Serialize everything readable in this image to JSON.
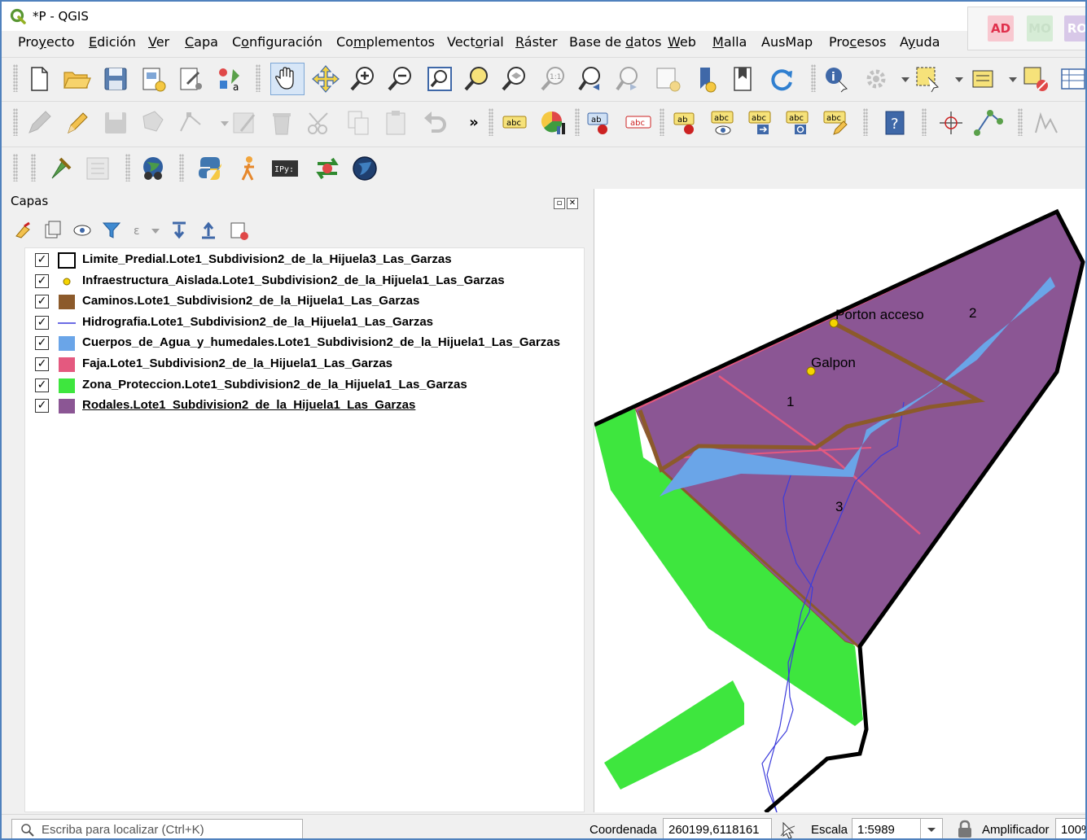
{
  "window": {
    "title": "*P - QGIS"
  },
  "corner_badges": [
    "AD",
    "MO",
    "RO"
  ],
  "menubar": [
    {
      "pre": "Pro",
      "ul": "y",
      "post": "ecto"
    },
    {
      "pre": "",
      "ul": "E",
      "post": "dición"
    },
    {
      "pre": "",
      "ul": "V",
      "post": "er"
    },
    {
      "pre": "",
      "ul": "C",
      "post": "apa"
    },
    {
      "pre": "C",
      "ul": "o",
      "post": "nfiguración"
    },
    {
      "pre": "Co",
      "ul": "m",
      "post": "plementos"
    },
    {
      "pre": "Vect",
      "ul": "o",
      "post": "rial"
    },
    {
      "pre": "",
      "ul": "R",
      "post": "áster"
    },
    {
      "pre": "Base de ",
      "ul": "d",
      "post": "atos"
    },
    {
      "pre": "",
      "ul": "W",
      "post": "eb"
    },
    {
      "pre": "",
      "ul": "M",
      "post": "alla"
    },
    {
      "pre": "AusMap",
      "ul": "",
      "post": ""
    },
    {
      "pre": "Pro",
      "ul": "c",
      "post": "esos"
    },
    {
      "pre": "A",
      "ul": "y",
      "post": "uda"
    }
  ],
  "toolbar": {
    "overflow": "»",
    "label_abc": "abc",
    "label_ab": "ab"
  },
  "layers_panel": {
    "title": "Capas",
    "layers": [
      {
        "checked": "✓",
        "symbol": "polygon-outline",
        "name": "Limite_Predial.Lote1_Subdivision2_de_la_Hijuela3_Las_Garzas",
        "color": "#000000"
      },
      {
        "checked": "✓",
        "symbol": "point",
        "name": "Infraestructura_Aislada.Lote1_Subdivision2_de_la_Hijuela1_Las_Garzas",
        "color": "#f5d400"
      },
      {
        "checked": "✓",
        "symbol": "fill",
        "name": "Caminos.Lote1_Subdivision2_de_la_Hijuela1_Las_Garzas",
        "color": "#8c5a2b"
      },
      {
        "checked": "✓",
        "symbol": "line",
        "name": "Hidrografia.Lote1_Subdivision2_de_la_Hijuela1_Las_Garzas",
        "color": "#3c3cdc"
      },
      {
        "checked": "✓",
        "symbol": "fill",
        "name": "Cuerpos_de_Agua_y_humedales.Lote1_Subdivision2_de_la_Hijuela1_Las_Garzas",
        "color": "#6aa5e8"
      },
      {
        "checked": "✓",
        "symbol": "fill",
        "name": "Faja.Lote1_Subdivision2_de_la_Hijuela1_Las_Garzas",
        "color": "#e4597f"
      },
      {
        "checked": "✓",
        "symbol": "fill",
        "name": "Zona_Proteccion.Lote1_Subdivision2_de_la_Hijuela1_Las_Garzas",
        "color": "#3ee63e"
      },
      {
        "checked": "✓",
        "symbol": "fill",
        "name": "Rodales.Lote1_Subdivision2_de_la_Hijuela1_Las_Garzas",
        "color": "#8b5694",
        "selected": true
      }
    ]
  },
  "map": {
    "labels": {
      "porton": "Porton acceso",
      "galpon": "Galpon",
      "stand1": "1",
      "stand2": "2",
      "stand3": "3"
    },
    "colors": {
      "stands": "#8b5694",
      "protection": "#3ee63e",
      "water": "#6aa5e8",
      "roads": "#8c5a2b",
      "strips": "#e4597f",
      "rivers": "#3c3cdc",
      "boundary": "#000000",
      "points": "#f5d400"
    }
  },
  "statusbar": {
    "locator_placeholder": "Escriba para localizar (Ctrl+K)",
    "coord_label": "Coordenada",
    "coord_value": "260199,6118161",
    "scale_label": "Escala",
    "scale_value": "1:5989",
    "magnifier_label": "Amplificador",
    "magnifier_value": "100%"
  }
}
